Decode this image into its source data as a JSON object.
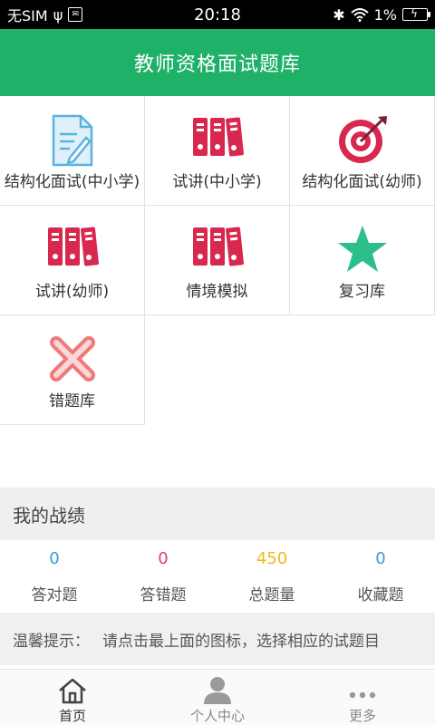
{
  "status_bar": {
    "carrier": "无SIM",
    "time": "20:18",
    "battery": "1%"
  },
  "header": {
    "title": "教师资格面试题库"
  },
  "grid": [
    {
      "label": "结构化面试(中小学)",
      "icon": "document-icon"
    },
    {
      "label": "试讲(中小学)",
      "icon": "binders-icon"
    },
    {
      "label": "结构化面试(幼师)",
      "icon": "target-icon"
    },
    {
      "label": "试讲(幼师)",
      "icon": "binders-icon"
    },
    {
      "label": "情境模拟",
      "icon": "binders-icon"
    },
    {
      "label": "复习库",
      "icon": "star-icon"
    },
    {
      "label": "错题库",
      "icon": "cross-icon"
    }
  ],
  "record": {
    "title": "我的战绩",
    "stats": [
      {
        "value": "0",
        "label": "答对题",
        "color": "#3a9bd8"
      },
      {
        "value": "0",
        "label": "答错题",
        "color": "#e04060"
      },
      {
        "value": "450",
        "label": "总题量",
        "color": "#f0b81a"
      },
      {
        "value": "0",
        "label": "收藏题",
        "color": "#3a9bd8"
      }
    ]
  },
  "tip": {
    "prefix": "温馨提示：",
    "text": "请点击最上面的图标，选择相应的试题目"
  },
  "nav": [
    {
      "label": "首页",
      "icon": "home-icon"
    },
    {
      "label": "个人中心",
      "icon": "user-icon"
    },
    {
      "label": "更多",
      "icon": "more-icon"
    }
  ],
  "colors": {
    "brand": "#1fb167",
    "binder": "#d8284f",
    "star": "#2bbf8a",
    "cross": "#ef7a7a"
  }
}
